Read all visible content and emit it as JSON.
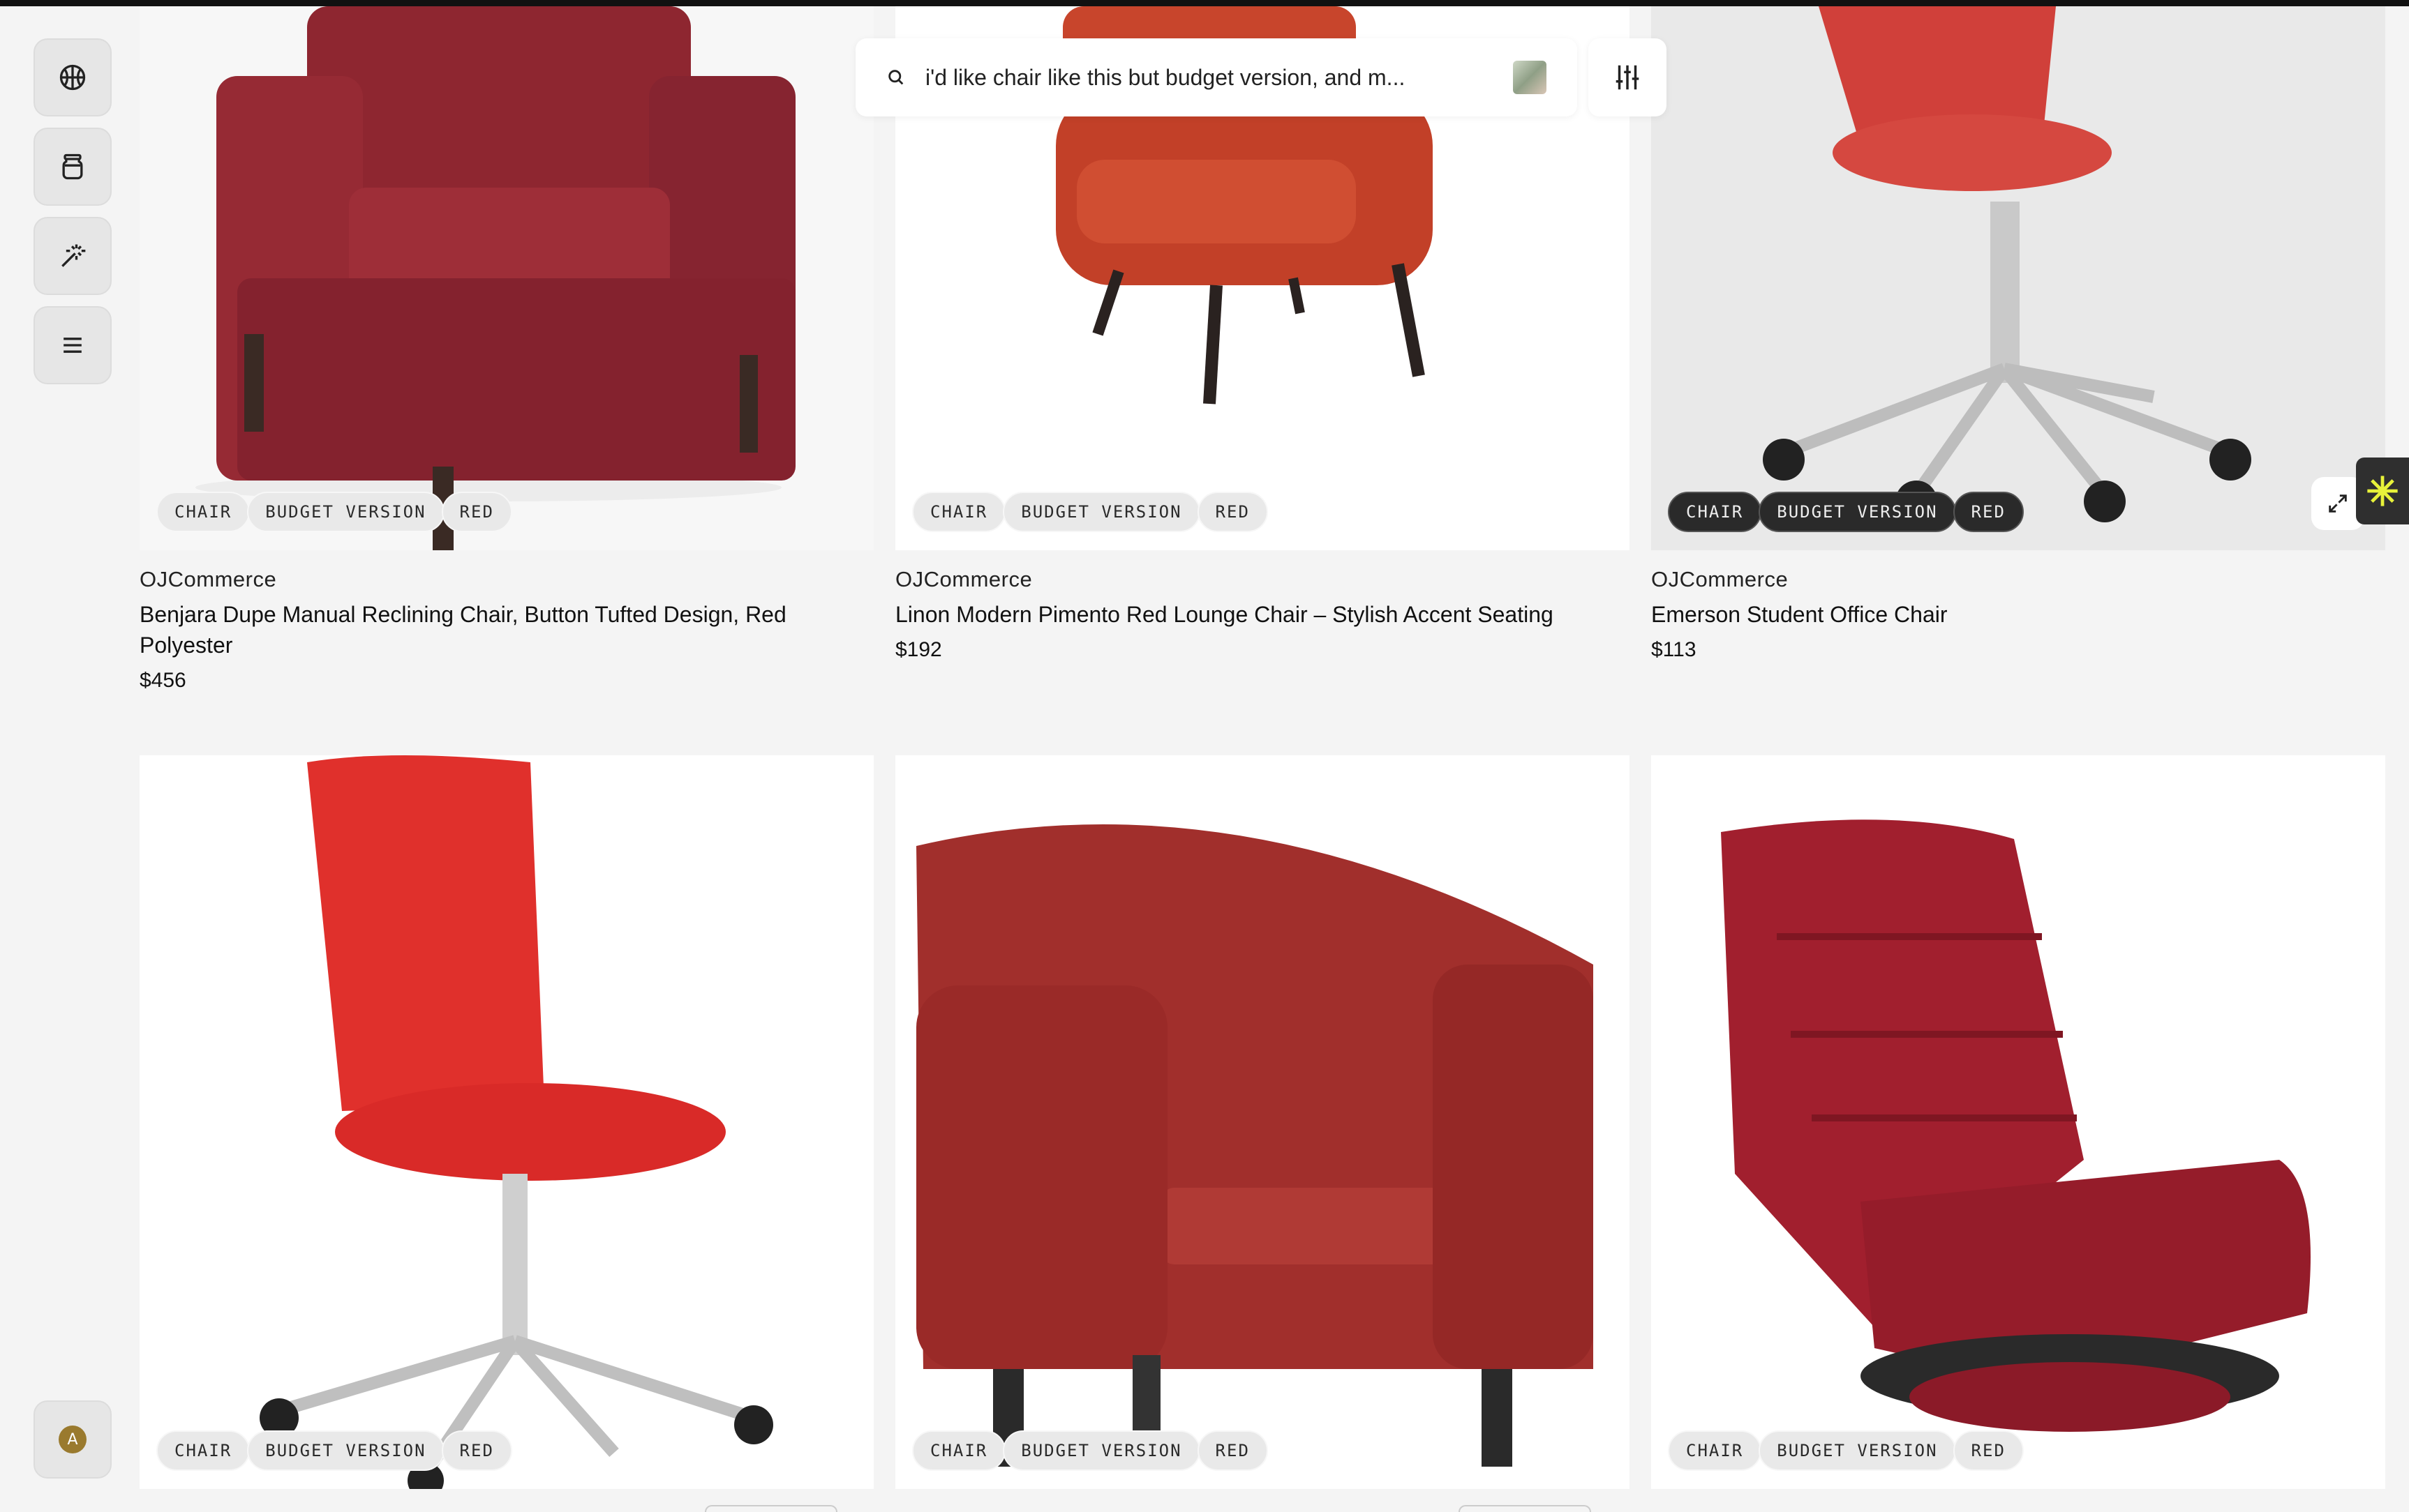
{
  "search": {
    "query": "i'd like chair like this but budget version, and m..."
  },
  "rail": {
    "items": [
      {
        "icon": "basketball-icon"
      },
      {
        "icon": "jar-icon"
      },
      {
        "icon": "magic-wand-icon"
      },
      {
        "icon": "menu-icon"
      }
    ],
    "avatar_initial": "A"
  },
  "products": [
    {
      "brand": "OJCommerce",
      "title": "Benjara Dupe Manual Reclining Chair, Button Tufted Design, Red Polyester",
      "price": "$456",
      "tags": [
        "CHAIR",
        "BUDGET VERSION",
        "RED"
      ],
      "color": "#8e2630"
    },
    {
      "brand": "OJCommerce",
      "title": "Linon Modern Pimento Red Lounge Chair – Stylish Accent Seating",
      "price": "$192",
      "tags": [
        "CHAIR",
        "BUDGET VERSION",
        "RED"
      ],
      "color": "#c8452c"
    },
    {
      "brand": "OJCommerce",
      "title": "Emerson Student Office Chair",
      "price": "$113",
      "tags": [
        "CHAIR",
        "BUDGET VERSION",
        "RED"
      ],
      "color": "#d0403a"
    },
    {
      "tags": [
        "CHAIR",
        "BUDGET VERSION",
        "RED"
      ],
      "color": "#e0302c"
    },
    {
      "tags": [
        "CHAIR",
        "BUDGET VERSION",
        "RED"
      ],
      "color": "#a12f2c"
    },
    {
      "tags": [
        "CHAIR",
        "BUDGET VERSION",
        "RED"
      ],
      "color": "#a11f2e"
    }
  ]
}
